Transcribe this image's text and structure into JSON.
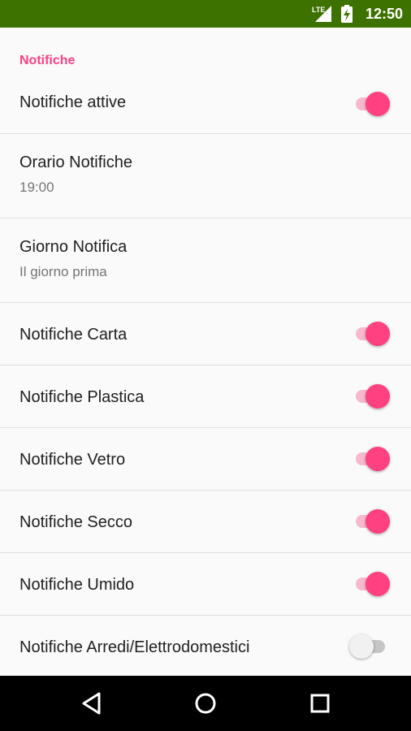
{
  "status_bar": {
    "network_label": "LTE",
    "time": "12:50",
    "background_color": "#3d7200",
    "icons": [
      "lte-signal-icon",
      "battery-charging-icon"
    ]
  },
  "section": {
    "header": "Notifiche",
    "accent_color": "#ff4081"
  },
  "settings": [
    {
      "title": "Notifiche attive",
      "switch": true
    },
    {
      "title": "Orario Notifiche",
      "summary": "19:00"
    },
    {
      "title": "Giorno Notifica",
      "summary": "Il giorno prima"
    },
    {
      "title": "Notifiche Carta",
      "switch": true
    },
    {
      "title": "Notifiche Plastica",
      "switch": true
    },
    {
      "title": "Notifiche Vetro",
      "switch": true
    },
    {
      "title": "Notifiche Secco",
      "switch": true
    },
    {
      "title": "Notifiche Umido",
      "switch": true
    },
    {
      "title": "Notifiche Arredi/Elettrodomestici",
      "switch": false
    }
  ],
  "navigation_bar": {
    "buttons": [
      "back-icon",
      "home-icon",
      "recent-apps-icon"
    ]
  }
}
